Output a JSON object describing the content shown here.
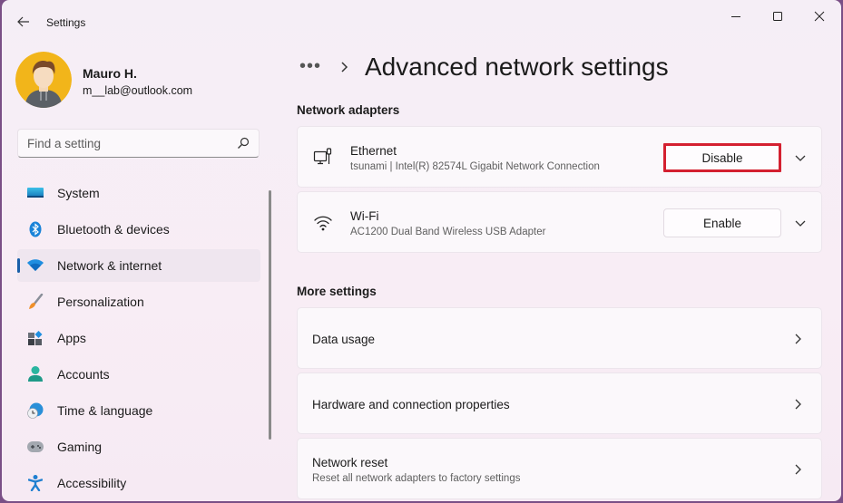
{
  "app": {
    "title": "Settings",
    "back_icon": "arrow-left-icon",
    "window_controls": [
      "minimize",
      "maximize",
      "close"
    ]
  },
  "profile": {
    "name": "Mauro H.",
    "email": "m__lab@outlook.com"
  },
  "search": {
    "placeholder": "Find a setting",
    "value": ""
  },
  "sidebar": {
    "items": [
      {
        "label": "System",
        "icon": "monitor-icon",
        "active": false
      },
      {
        "label": "Bluetooth & devices",
        "icon": "bluetooth-icon",
        "active": false
      },
      {
        "label": "Network & internet",
        "icon": "wifi-icon",
        "active": true
      },
      {
        "label": "Personalization",
        "icon": "brush-icon",
        "active": false
      },
      {
        "label": "Apps",
        "icon": "apps-icon",
        "active": false
      },
      {
        "label": "Accounts",
        "icon": "person-icon",
        "active": false
      },
      {
        "label": "Time & language",
        "icon": "globe-clock-icon",
        "active": false
      },
      {
        "label": "Gaming",
        "icon": "gamepad-icon",
        "active": false
      },
      {
        "label": "Accessibility",
        "icon": "accessibility-icon",
        "active": false
      }
    ]
  },
  "header": {
    "breadcrumb_more": "•••",
    "title": "Advanced network settings"
  },
  "network_adapters": {
    "section_title": "Network adapters",
    "items": [
      {
        "name": "Ethernet",
        "description": "tsunami | Intel(R) 82574L Gigabit Network Connection",
        "button": "Disable",
        "highlighted": true,
        "icon": "ethernet-icon"
      },
      {
        "name": "Wi-Fi",
        "description": "AC1200  Dual Band Wireless USB Adapter",
        "button": "Enable",
        "highlighted": false,
        "icon": "wifi-icon"
      }
    ]
  },
  "more_settings": {
    "section_title": "More settings",
    "items": [
      {
        "title": "Data usage",
        "subtitle": ""
      },
      {
        "title": "Hardware and connection properties",
        "subtitle": ""
      },
      {
        "title": "Network reset",
        "subtitle": "Reset all network adapters to factory settings"
      }
    ]
  },
  "colors": {
    "accent": "#1a5fa8",
    "highlight_border": "#d42030",
    "background": "#f5eef6"
  }
}
